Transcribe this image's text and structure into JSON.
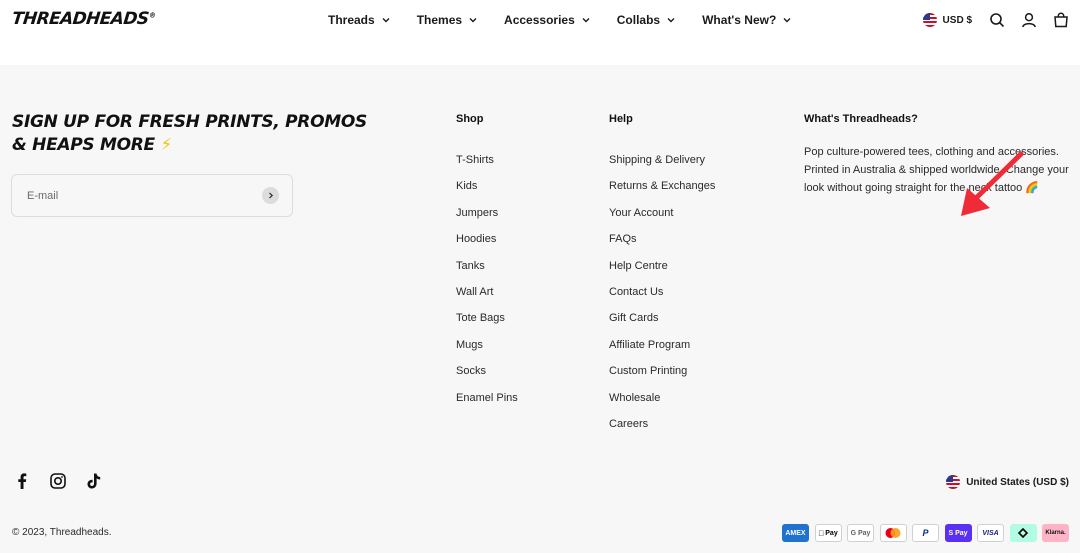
{
  "header": {
    "logo": "THREADHEADS",
    "logo_mark": "®",
    "nav": [
      {
        "label": "Threads"
      },
      {
        "label": "Themes"
      },
      {
        "label": "Accessories"
      },
      {
        "label": "Collabs"
      },
      {
        "label": "What's New?"
      }
    ],
    "currency": "USD $",
    "icons": [
      "search-icon",
      "account-icon",
      "cart-icon"
    ]
  },
  "signup": {
    "title": "Sign up for fresh prints, promos & heaps more",
    "emoji": "⚡",
    "email_placeholder": "E-mail"
  },
  "shop": {
    "title": "Shop",
    "items": [
      "T-Shirts",
      "Kids",
      "Jumpers",
      "Hoodies",
      "Tanks",
      "Wall Art",
      "Tote Bags",
      "Mugs",
      "Socks",
      "Enamel Pins"
    ]
  },
  "help": {
    "title": "Help",
    "items": [
      "Shipping & Delivery",
      "Returns & Exchanges",
      "Your Account",
      "FAQs",
      "Help Centre",
      "Contact Us",
      "Gift Cards",
      "Affiliate Program",
      "Custom Printing",
      "Wholesale",
      "Careers"
    ]
  },
  "about": {
    "title": "What's Threadheads?",
    "text": "Pop culture-powered tees, clothing and accessories. Printed in Australia & shipped worldwide. Change your look without going straight for the neck tattoo 🌈"
  },
  "socials": [
    "facebook-icon",
    "instagram-icon",
    "tiktok-icon"
  ],
  "country": "United States (USD $)",
  "copyright": "© 2023, Threadheads.",
  "payments": [
    {
      "label": "AMEX",
      "bg": "#1f72cd",
      "fg": "#ffffff"
    },
    {
      "label": "Pay",
      "bg": "#ffffff",
      "fg": "#000000"
    },
    {
      "label": "G Pay",
      "bg": "#ffffff",
      "fg": "#5f6368"
    },
    {
      "label": "",
      "bg": "#ffffff",
      "fg": "#000000"
    },
    {
      "label": "P",
      "bg": "#ffffff",
      "fg": "#003087"
    },
    {
      "label": "S Pay",
      "bg": "#5a31f4",
      "fg": "#ffffff"
    },
    {
      "label": "VISA",
      "bg": "#ffffff",
      "fg": "#1a1f71"
    },
    {
      "label": "",
      "bg": "#b2fce4",
      "fg": "#000000"
    },
    {
      "label": "Klarna.",
      "bg": "#ffb3c7",
      "fg": "#17120f"
    }
  ],
  "colors": {
    "header_bg": "#ffffff",
    "footer_bg": "#f7f7f7",
    "annotation_arrow": "#ee2b36"
  }
}
